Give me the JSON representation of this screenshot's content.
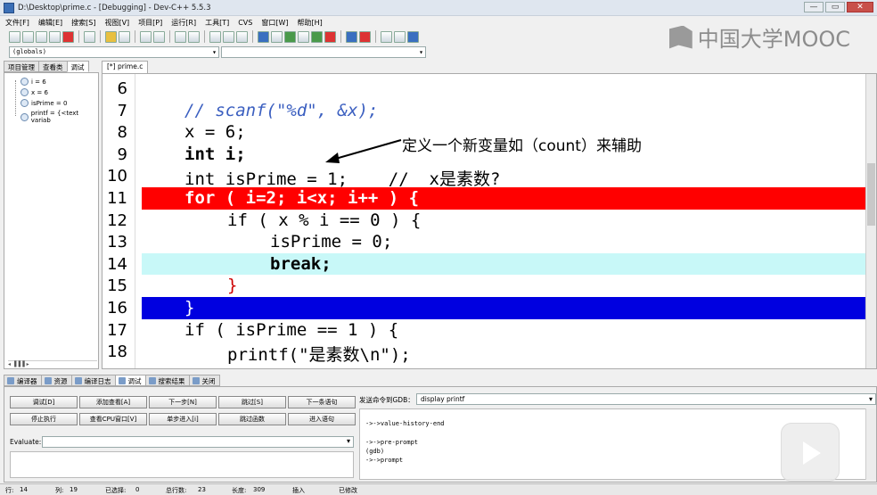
{
  "window": {
    "title": "D:\\Desktop\\prime.c - [Debugging] - Dev-C++ 5.5.3",
    "minimize": "—",
    "maximize": "▭",
    "close": "✕"
  },
  "menu": [
    "文件[F]",
    "编辑[E]",
    "搜索[S]",
    "视图[V]",
    "项目[P]",
    "运行[R]",
    "工具[T]",
    "CVS",
    "窗口[W]",
    "帮助[H]"
  ],
  "watermark": {
    "text": "中国大学MOOC"
  },
  "combos": {
    "scope": "(globals)",
    "second": ""
  },
  "left_tabs": [
    "项目管理",
    "查看类",
    "调试"
  ],
  "watches": [
    "i = 6",
    "x = 6",
    "isPrime = 0",
    "printf = {<text variab"
  ],
  "left_scroll": "◂ ▐▐▐ ▸",
  "editor": {
    "tab": "[*] prime.c",
    "lines": [
      {
        "n": "6",
        "text": ""
      },
      {
        "n": "7",
        "text": "// scanf(\"%d\", &x);"
      },
      {
        "n": "8",
        "text": "x = 6;"
      },
      {
        "n": "9",
        "text": "int i;"
      },
      {
        "n": "10",
        "text": "int isPrime = 1;    //  x是素数?"
      },
      {
        "n": "11",
        "text": "for ( i=2; i<x; i++ ) {"
      },
      {
        "n": "12",
        "text": "if ( x % i == 0 ) {"
      },
      {
        "n": "13",
        "text": "isPrime = 0;"
      },
      {
        "n": "14",
        "text": "break;"
      },
      {
        "n": "15",
        "text": "}"
      },
      {
        "n": "16",
        "text": "}"
      },
      {
        "n": "17",
        "text": "if ( isPrime == 1 ) {"
      },
      {
        "n": "18",
        "text": "printf(\"是素数\\n\");"
      }
    ]
  },
  "annotation": "定义一个新变量如（count）来辅助",
  "bottom_tabs": [
    "编译器",
    "资源",
    "编译日志",
    "调试",
    "搜索结果",
    "关闭"
  ],
  "debug_buttons": [
    [
      "调试[D]",
      "添加查看[A]",
      "下一步[N]",
      "跳过[S]",
      "下一条语句"
    ],
    [
      "停止执行",
      "查看CPU窗口[V]",
      "单步进入[i]",
      "跳过函数",
      "进入语句"
    ]
  ],
  "evaluate_label": "Evaluate:",
  "gdb": {
    "label": "发送命令到GDB：",
    "command": "display printf",
    "output": [
      "->->value-history-end",
      "",
      "->->pre-prompt",
      "(gdb)",
      "->->prompt"
    ]
  },
  "status": {
    "row_label": "行:",
    "row": "14",
    "col_label": "列:",
    "col": "19",
    "sel_label": "已选择:",
    "sel": "0",
    "total_label": "总行数:",
    "total": "23",
    "len_label": "长度:",
    "len": "309",
    "mode": "插入",
    "state": "已修改"
  },
  "colors": {
    "breakpoint_line": "#ff0000",
    "current_line": "#0000e0",
    "caret_line": "#c8f8f8"
  }
}
